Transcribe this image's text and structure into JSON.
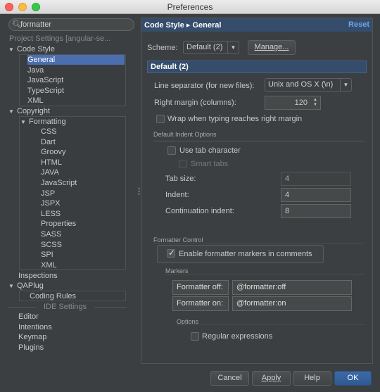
{
  "window": {
    "title": "Preferences"
  },
  "sidebar": {
    "search_value": "formatter",
    "project_settings_label": "Project Settings [angular-se...",
    "code_style": "Code Style",
    "code_style_items": [
      "General",
      "Java",
      "JavaScript",
      "TypeScript",
      "XML"
    ],
    "copyright": "Copyright",
    "formatting": "Formatting",
    "formatting_items": [
      "CSS",
      "Dart",
      "Groovy",
      "HTML",
      "JAVA",
      "JavaScript",
      "JSP",
      "JSPX",
      "LESS",
      "Properties",
      "SASS",
      "SCSS",
      "SPI",
      "XML"
    ],
    "inspections": "Inspections",
    "qaplug": "QAPlug",
    "coding_rules": "Coding Rules",
    "ide_settings_label": "IDE Settings",
    "ide_items": [
      "Editor",
      "Intentions",
      "Keymap",
      "Plugins"
    ]
  },
  "panel": {
    "header_title": "Code Style ▸ General",
    "reset_label": "Reset",
    "scheme_label": "Scheme:",
    "scheme_value": "Default (2)",
    "manage_button": "Manage...",
    "bar_title": "Default (2)",
    "line_separator_label": "Line separator (for new files):",
    "line_separator_value": "Unix and OS X (\\n)",
    "right_margin_label": "Right margin (columns):",
    "right_margin_value": "120",
    "wrap_label": "Wrap when typing reaches right margin",
    "wrap_checked": false,
    "default_indent_title": "Default Indent Options",
    "use_tab_label": "Use tab character",
    "use_tab_checked": false,
    "smart_tabs_label": "Smart tabs",
    "smart_tabs_checked": false,
    "tab_size_label": "Tab size:",
    "tab_size_value": "4",
    "indent_label": "Indent:",
    "indent_value": "4",
    "continuation_label": "Continuation indent:",
    "continuation_value": "8",
    "formatter_control_title": "Formatter Control",
    "enable_markers_label": "Enable formatter markers in comments",
    "enable_markers_checked": true,
    "markers_title": "Markers",
    "formatter_off_label": "Formatter off:",
    "formatter_off_value": "@formatter:off",
    "formatter_on_label": "Formatter on:",
    "formatter_on_value": "@formatter:on",
    "options_title": "Options",
    "regex_label": "Regular expressions",
    "regex_checked": false
  },
  "footer": {
    "cancel": "Cancel",
    "apply": "Apply",
    "help": "Help",
    "ok": "OK"
  },
  "colors": {
    "background": "#3c3f41",
    "selection": "#4b6eaf",
    "header": "#354c6b",
    "link": "#6fa4ea"
  }
}
